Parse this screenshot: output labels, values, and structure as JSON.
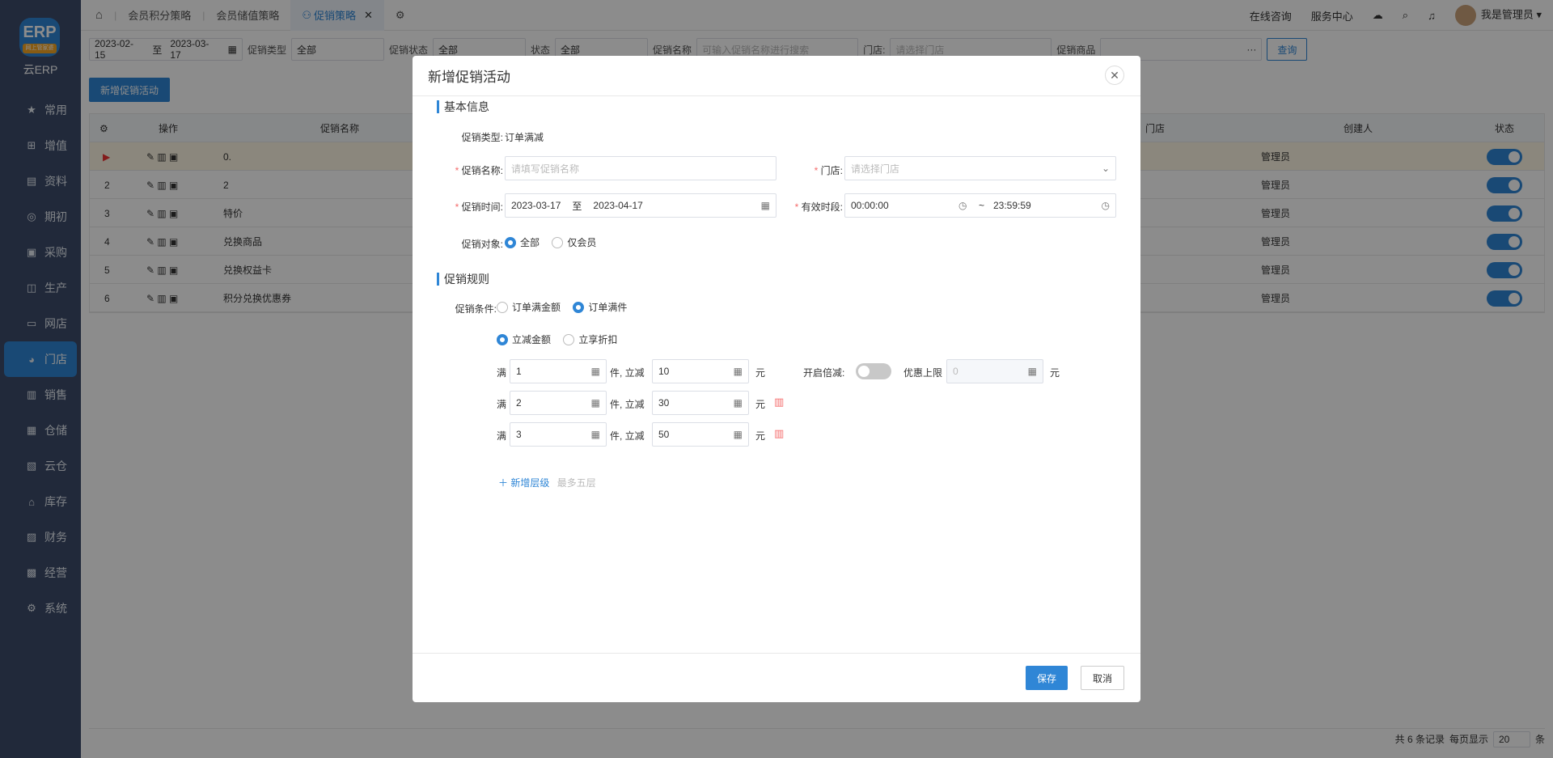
{
  "sidebar": {
    "logo_badge": "网上管家婆",
    "logo_text": "云ERP",
    "items": [
      {
        "label": "常用",
        "icon": "star-icon"
      },
      {
        "label": "增值",
        "icon": "plus-box-icon"
      },
      {
        "label": "资料",
        "icon": "document-icon"
      },
      {
        "label": "期初",
        "icon": "target-icon"
      },
      {
        "label": "采购",
        "icon": "cart-icon"
      },
      {
        "label": "生产",
        "icon": "factory-icon"
      },
      {
        "label": "网店",
        "icon": "shop-icon"
      },
      {
        "label": "门店",
        "icon": "store-icon"
      },
      {
        "label": "销售",
        "icon": "sales-icon"
      },
      {
        "label": "仓储",
        "icon": "warehouse-icon"
      },
      {
        "label": "云仓",
        "icon": "cloud-warehouse-icon"
      },
      {
        "label": "库存",
        "icon": "inventory-icon"
      },
      {
        "label": "财务",
        "icon": "finance-icon"
      },
      {
        "label": "经营",
        "icon": "chart-icon"
      },
      {
        "label": "系统",
        "icon": "gear-icon"
      }
    ]
  },
  "tabs": {
    "t1": "会员积分策略",
    "t2": "会员储值策略",
    "t3": "促销策略"
  },
  "topbar": {
    "consult": "在线咨询",
    "service": "服务中心",
    "user": "我是管理员"
  },
  "filter": {
    "date_from": "2023-02-15",
    "to": "至",
    "date_to": "2023-03-17",
    "type_label": "促销类型",
    "type_value": "全部",
    "status_label": "促销状态",
    "status_value": "全部",
    "state_label": "状态",
    "state_value": "全部",
    "name_label": "促销名称",
    "name_placeholder": "可输入促销名称进行搜索",
    "store_label": "门店:",
    "store_placeholder": "请选择门店",
    "goods_label": "促销商品",
    "query": "查询"
  },
  "add_button": "新增促销活动",
  "grid": {
    "headers": {
      "op": "操作",
      "name": "促销名称",
      "store": "门店",
      "creator": "创建人",
      "status": "状态"
    },
    "rows": [
      {
        "no": "",
        "name": "0.",
        "creator": "管理员"
      },
      {
        "no": "2",
        "name": "2",
        "creator": "管理员"
      },
      {
        "no": "3",
        "name": "特价",
        "creator": "管理员"
      },
      {
        "no": "4",
        "name": "兑换商品",
        "creator": "管理员"
      },
      {
        "no": "5",
        "name": "兑换权益卡",
        "creator": "管理员"
      },
      {
        "no": "6",
        "name": "积分兑换优惠券",
        "creator": "管理员"
      }
    ]
  },
  "footer": {
    "total": "共 6 条记录",
    "per_page_label": "每页显示",
    "per_page": "20",
    "unit": "条"
  },
  "modal": {
    "title": "新增促销活动",
    "basic_title": "基本信息",
    "type_label": "促销类型:",
    "type_value": "订单满减",
    "name_label": "促销名称:",
    "name_placeholder": "请填写促销名称",
    "store_label": "门店:",
    "store_placeholder": "请选择门店",
    "time_label": "促销时间:",
    "time_from": "2023-03-17",
    "time_to_sep": "至",
    "time_to": "2023-04-17",
    "period_label": "有效时段:",
    "period_from": "00:00:00",
    "period_sep": "~",
    "period_to": "23:59:59",
    "target_label": "促销对象:",
    "target_all": "全部",
    "target_member": "仅会员",
    "rule_title": "促销规则",
    "cond_label": "促销条件:",
    "cond_amount": "订单满金额",
    "cond_count": "订单满件",
    "mode_reduce": "立减金额",
    "mode_discount": "立享折扣",
    "tiers": [
      {
        "full": "满",
        "count": "1",
        "mid": "件, 立减",
        "amount": "10",
        "unit": "元"
      },
      {
        "full": "满",
        "count": "2",
        "mid": "件, 立减",
        "amount": "30",
        "unit": "元"
      },
      {
        "full": "满",
        "count": "3",
        "mid": "件, 立减",
        "amount": "50",
        "unit": "元"
      }
    ],
    "double_label": "开启倍减:",
    "limit_label": "优惠上限",
    "limit_value": "0",
    "limit_unit": "元",
    "add_tier": "新增层级",
    "add_tier_hint": "最多五层",
    "save": "保存",
    "cancel": "取消"
  }
}
